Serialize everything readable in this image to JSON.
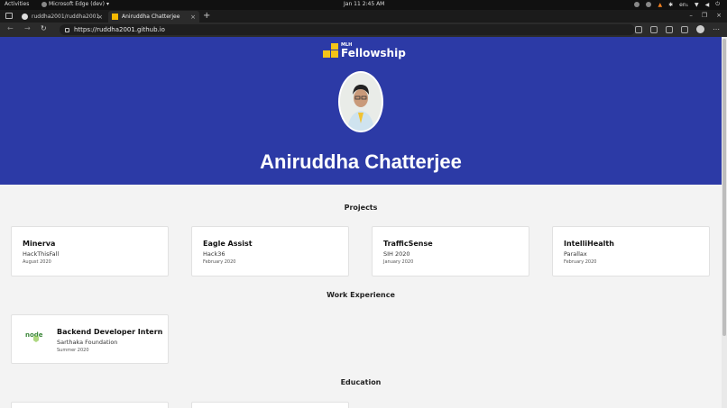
{
  "topbar": {
    "activities": "Activities",
    "app_name": "Microsoft Edge (dev)",
    "clock": "Jan 11  2:45 AM",
    "lang": "en₁"
  },
  "tabs": [
    {
      "label": "ruddha2001/ruddha2001",
      "icon": "github-icon"
    },
    {
      "label": "Aniruddha Chatterjee",
      "icon": "mlh-icon"
    }
  ],
  "address": {
    "url": "https://ruddha2001.github.io"
  },
  "hero": {
    "logo_small": "MLH",
    "logo_big": "Fellowship",
    "name": "Aniruddha Chatterjee"
  },
  "sections": {
    "projects": "Projects",
    "work": "Work Experience",
    "education": "Education"
  },
  "projects": [
    {
      "title": "Minerva",
      "event": "HackThisFall",
      "date": "August 2020"
    },
    {
      "title": "Eagle Assist",
      "event": "Hack36",
      "date": "February 2020"
    },
    {
      "title": "TrafficSense",
      "event": "SIH 2020",
      "date": "January 2020"
    },
    {
      "title": "IntelliHealth",
      "event": "Parallax",
      "date": "February 2020"
    }
  ],
  "work": [
    {
      "title": "Backend Developer Intern",
      "org": "Sarthaka Foundation",
      "date": "Summer 2020",
      "logo": "node"
    }
  ],
  "colors": {
    "hero_bg": "#2c3aa6",
    "mlh_yellow": "#f5c518",
    "node_green": "#3c873a"
  }
}
